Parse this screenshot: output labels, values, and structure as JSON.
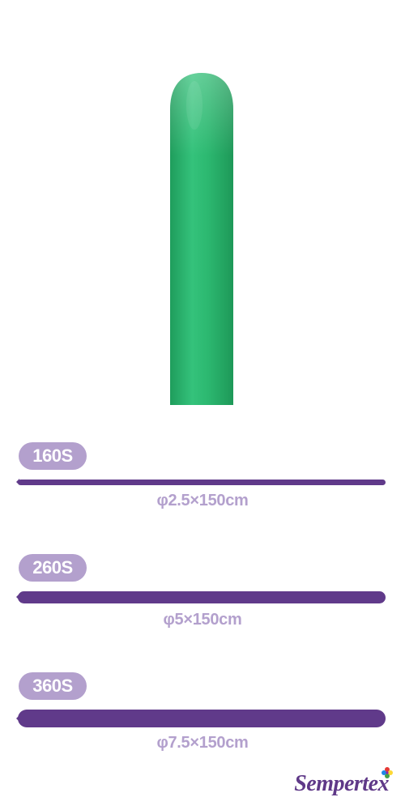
{
  "colors": {
    "balloon": "#26b66c",
    "badge": "#b3a0cd",
    "rod": "#603a8a",
    "dimension_text": "#b3a0cd",
    "logo": "#5f3988"
  },
  "product": {
    "icon": "modelling-balloon-green"
  },
  "sizes": [
    {
      "badge": "160S",
      "dimension": "φ2.5×150cm"
    },
    {
      "badge": "260S",
      "dimension": "φ5×150cm"
    },
    {
      "badge": "360S",
      "dimension": "φ7.5×150cm"
    }
  ],
  "brand": {
    "logo_text": "Sempertex"
  }
}
